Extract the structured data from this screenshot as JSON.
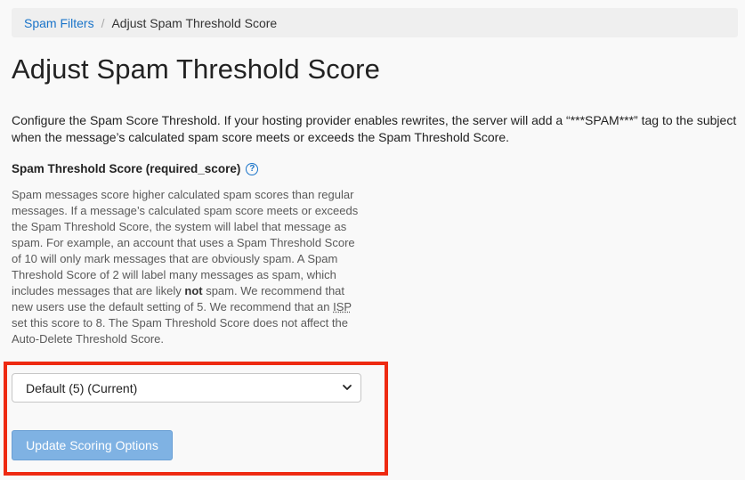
{
  "breadcrumb": {
    "parent": "Spam Filters",
    "separator": "/",
    "current": "Adjust Spam Threshold Score"
  },
  "page_title": "Adjust Spam Threshold Score",
  "intro": "Configure the Spam Score Threshold. If your hosting provider enables rewrites, the server will add a “***SPAM***” tag to the subject when the message’s calculated spam score meets or exceeds the Spam Threshold Score.",
  "field": {
    "label": "Spam Threshold Score (required_score)",
    "help_icon": "question-circle-icon",
    "help_text": {
      "part1": "Spam messages score higher calculated spam scores than regular messages. If a message’s calculated spam score meets or exceeds the Spam Threshold Score, the system will label that message as spam. For example, an account that uses a Spam Threshold Score of 10 will only mark messages that are obviously spam. A Spam Threshold Score of 2 will label many messages as spam, which includes messages that are likely ",
      "bold": "not",
      "part2": " spam. We recommend that new users use the default setting of 5. We recommend that an ",
      "abbr": "ISP",
      "part3": " set this score to 8. The Spam Threshold Score does not affect the Auto-Delete Threshold Score."
    },
    "select_value": "Default (5) (Current)"
  },
  "button": {
    "update_label": "Update Scoring Options"
  },
  "colors": {
    "link": "#1a74c9",
    "button_bg": "#7fb2e3",
    "highlight": "#ee2a12"
  }
}
